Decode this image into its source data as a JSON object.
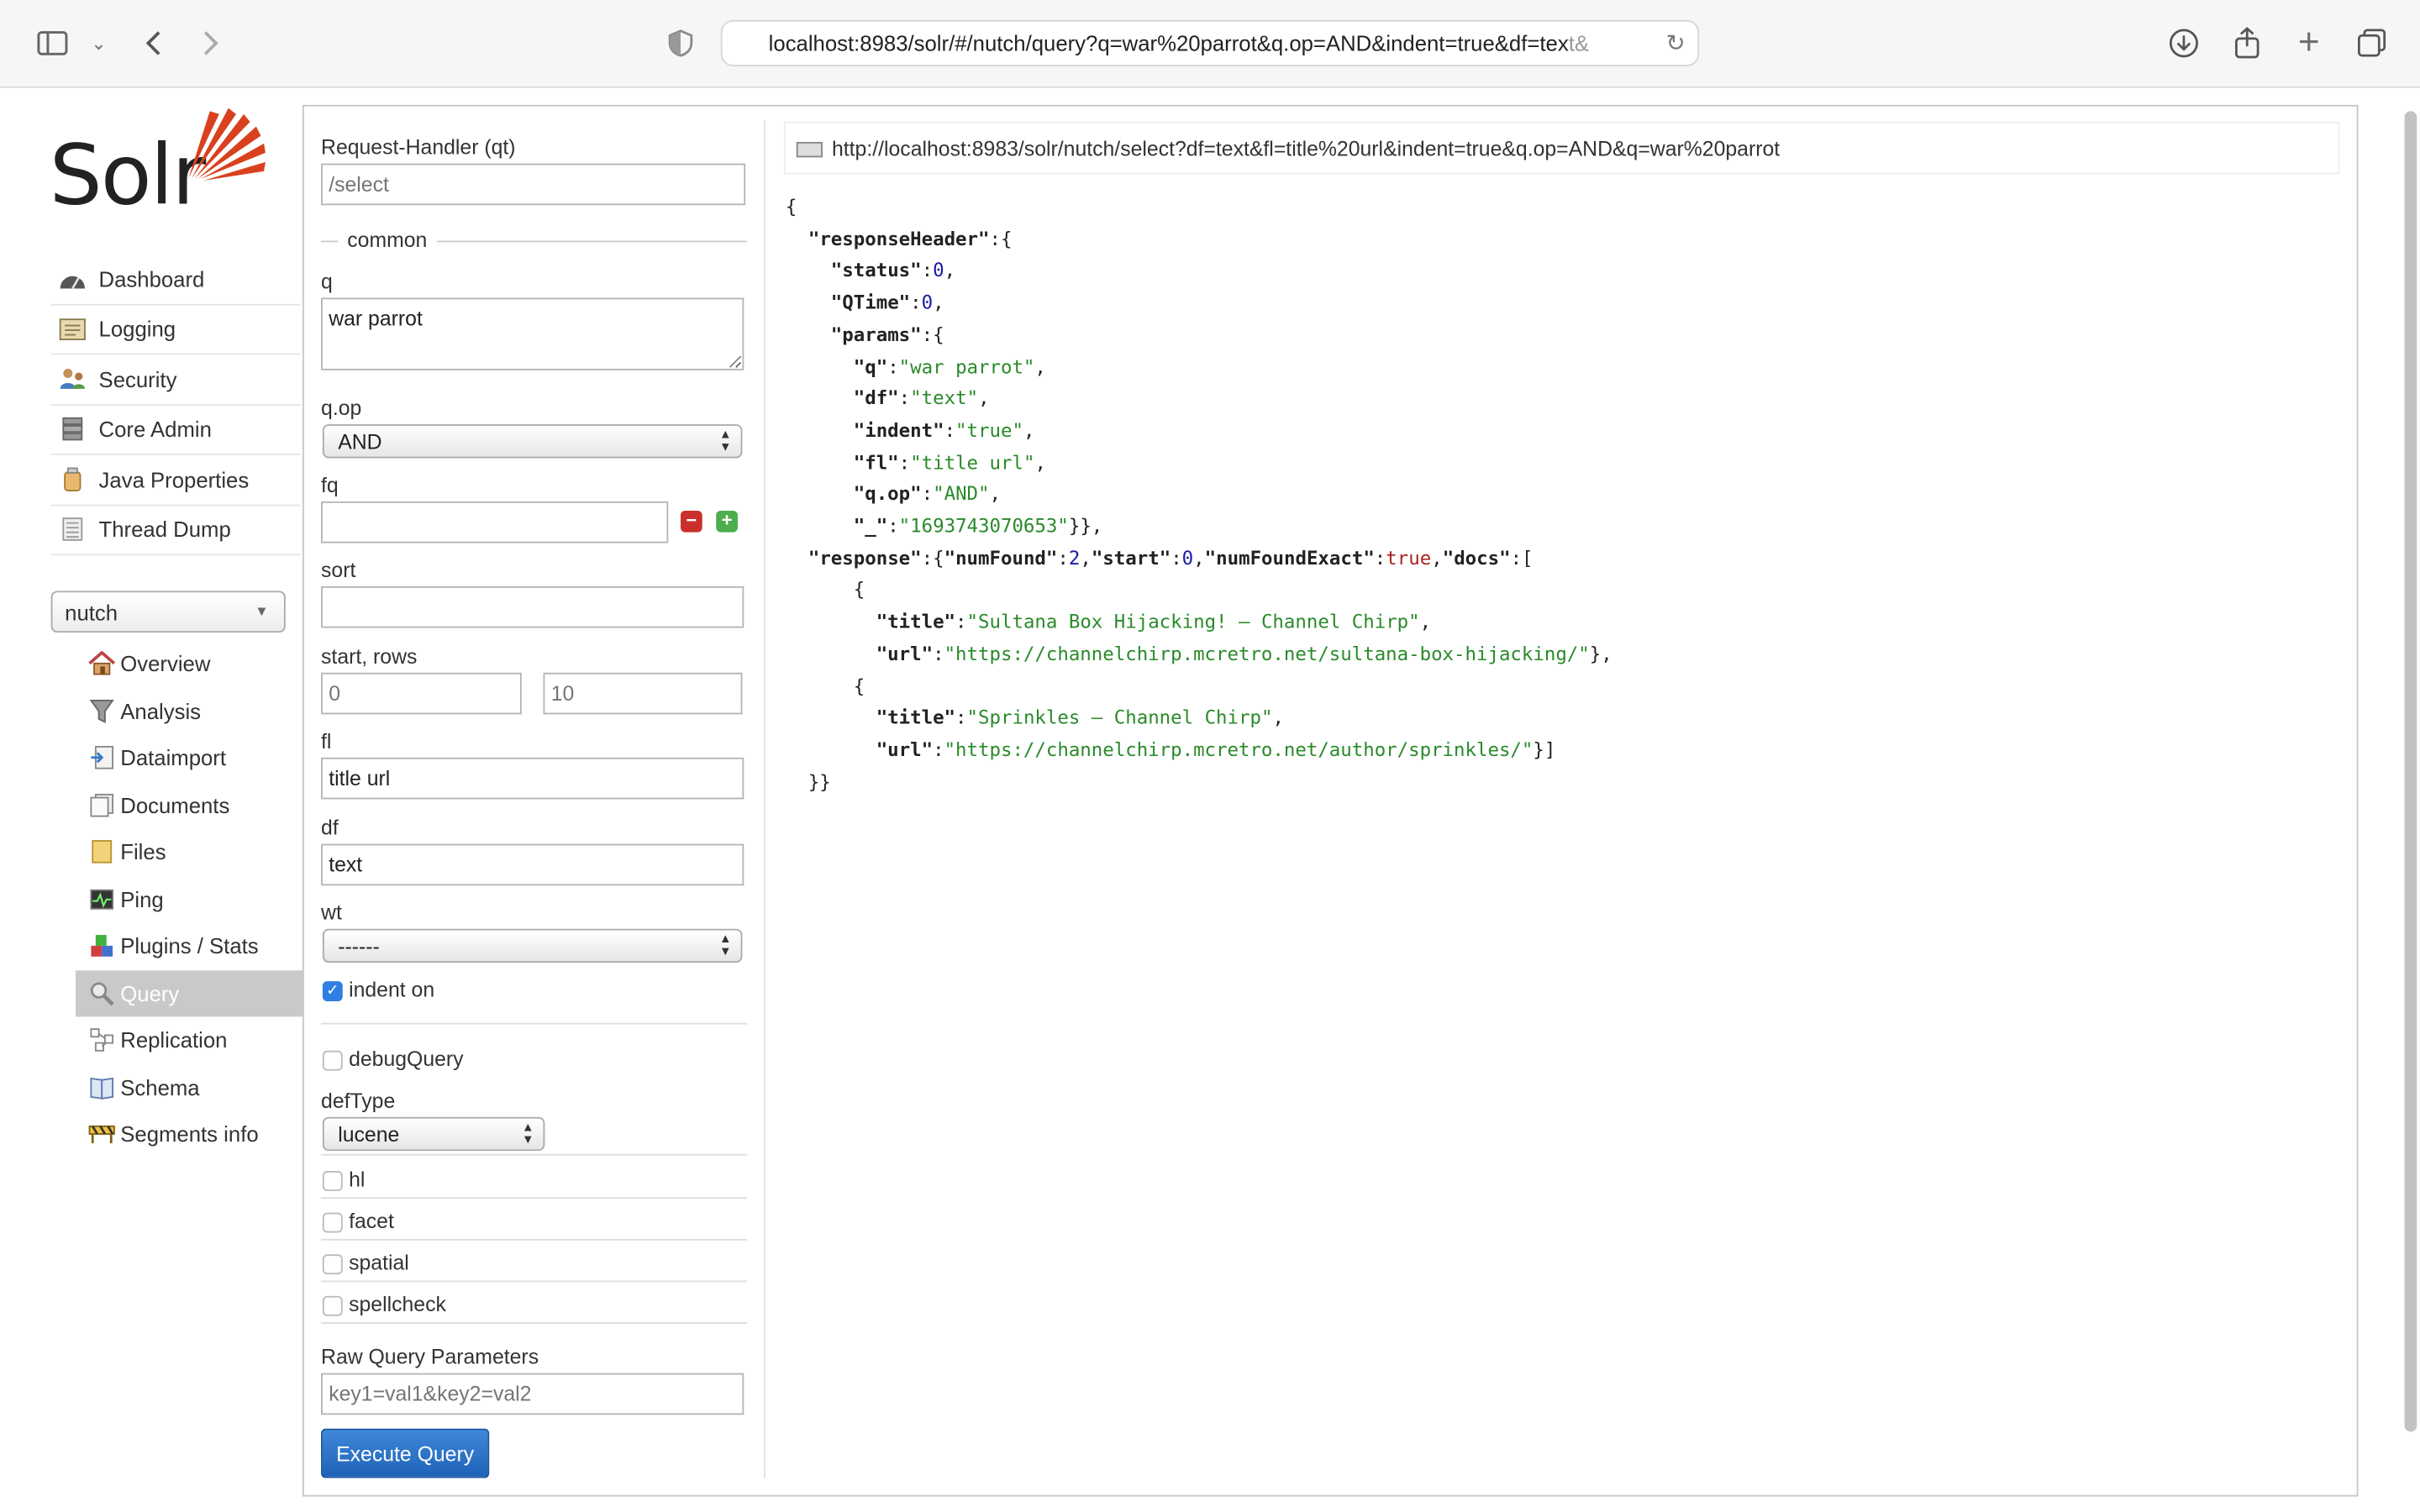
{
  "browser": {
    "url_main": "localhost:8983/solr/#/nutch/query?q=war%20parrot&q.op=AND&indent=true&df=tex",
    "url_fade": "t&"
  },
  "app": {
    "logo_text": "Solr"
  },
  "nav": {
    "items": [
      {
        "label": "Dashboard",
        "icon": "dashboard-icon"
      },
      {
        "label": "Logging",
        "icon": "logging-icon"
      },
      {
        "label": "Security",
        "icon": "security-icon"
      },
      {
        "label": "Core Admin",
        "icon": "core-admin-icon"
      },
      {
        "label": "Java Properties",
        "icon": "java-properties-icon"
      },
      {
        "label": "Thread Dump",
        "icon": "thread-dump-icon"
      }
    ],
    "core_selected": "nutch",
    "core_items": [
      {
        "label": "Overview",
        "icon": "home-icon"
      },
      {
        "label": "Analysis",
        "icon": "funnel-icon"
      },
      {
        "label": "Dataimport",
        "icon": "dataimport-icon"
      },
      {
        "label": "Documents",
        "icon": "documents-icon"
      },
      {
        "label": "Files",
        "icon": "folder-icon"
      },
      {
        "label": "Ping",
        "icon": "ping-icon"
      },
      {
        "label": "Plugins / Stats",
        "icon": "plugins-icon"
      },
      {
        "label": "Query",
        "icon": "query-icon",
        "active": true
      },
      {
        "label": "Replication",
        "icon": "replication-icon"
      },
      {
        "label": "Schema",
        "icon": "schema-icon"
      },
      {
        "label": "Segments info",
        "icon": "segments-icon"
      }
    ]
  },
  "form": {
    "request_handler_label": "Request-Handler (qt)",
    "request_handler_placeholder": "/select",
    "common_legend": "common",
    "q_label": "q",
    "q_value": "war parrot",
    "qop_label": "q.op",
    "qop_value": "AND",
    "fq_label": "fq",
    "fq_value": "",
    "sort_label": "sort",
    "sort_value": "",
    "start_rows_label": "start, rows",
    "start_placeholder": "0",
    "rows_placeholder": "10",
    "fl_label": "fl",
    "fl_value": "title url",
    "df_label": "df",
    "df_value": "text",
    "wt_label": "wt",
    "wt_value": "------",
    "indent_label": "indent on",
    "indent_checked": true,
    "debug_label": "debugQuery",
    "deftype_label": "defType",
    "deftype_value": "lucene",
    "hl_label": "hl",
    "facet_label": "facet",
    "spatial_label": "spatial",
    "spellcheck_label": "spellcheck",
    "raw_label": "Raw Query Parameters",
    "raw_placeholder": "key1=val1&key2=val2",
    "execute_label": "Execute Query"
  },
  "result": {
    "request_url": "http://localhost:8983/solr/nutch/select?df=text&fl=title%20url&indent=true&q.op=AND&q=war%20parrot",
    "status": "0",
    "qtime": "0",
    "params": {
      "q": "war parrot",
      "df": "text",
      "indent": "true",
      "fl": "title url",
      "q_op": "AND",
      "underscore": "1693743070653"
    },
    "num_found": "2",
    "start": "0",
    "num_found_exact": "true",
    "docs": [
      {
        "title": "Sultana Box Hijacking! – Channel Chirp",
        "url": "https://channelchirp.mcretro.net/sultana-box-hijacking/"
      },
      {
        "title": "Sprinkles – Channel Chirp",
        "url": "https://channelchirp.mcretro.net/author/sprinkles/"
      }
    ]
  }
}
